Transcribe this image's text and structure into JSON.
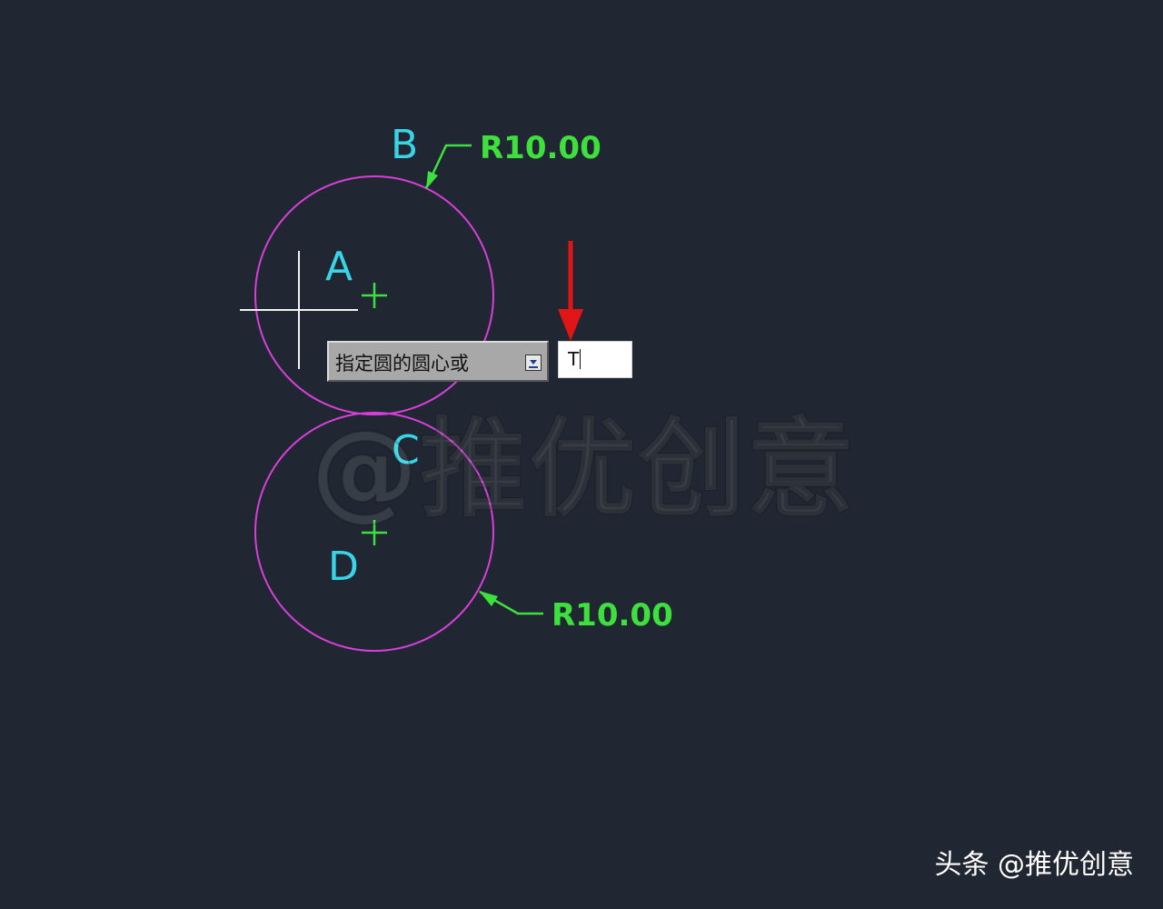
{
  "canvas": {
    "background_color": "#212732",
    "circle_color": "#d63fd8",
    "label_color": "#38d4e8",
    "dimension_color": "#3ee03e",
    "crosshair_color": "#f2f2f2",
    "pointer_arrow_color": "#e01515"
  },
  "labels": {
    "a": "A",
    "b": "B",
    "c": "C",
    "d": "D"
  },
  "dimensions": {
    "top": "R10.00",
    "bottom": "R10.00"
  },
  "dynamic_input": {
    "prompt": "指定圆的圆心或",
    "options_icon": "dropdown-arrow-icon",
    "command_value": "T"
  },
  "watermark": "@推优创意",
  "footer": {
    "brand": "头条 @推优创意"
  }
}
